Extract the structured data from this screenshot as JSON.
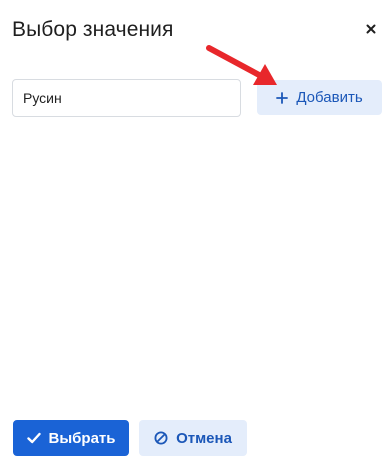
{
  "dialog": {
    "title": "Выбор значения",
    "close_icon": "close-icon"
  },
  "form": {
    "input_value": "Русин",
    "add_label": "Добавить",
    "add_icon": "plus-icon"
  },
  "annotation": {
    "arrow_color": "#e8272b"
  },
  "footer": {
    "select_label": "Выбрать",
    "select_icon": "check-icon",
    "cancel_label": "Отмена",
    "cancel_icon": "cancel-icon"
  },
  "colors": {
    "primary": "#1a63d6",
    "secondary_bg": "#e4edfb",
    "secondary_text": "#1b57b8"
  }
}
